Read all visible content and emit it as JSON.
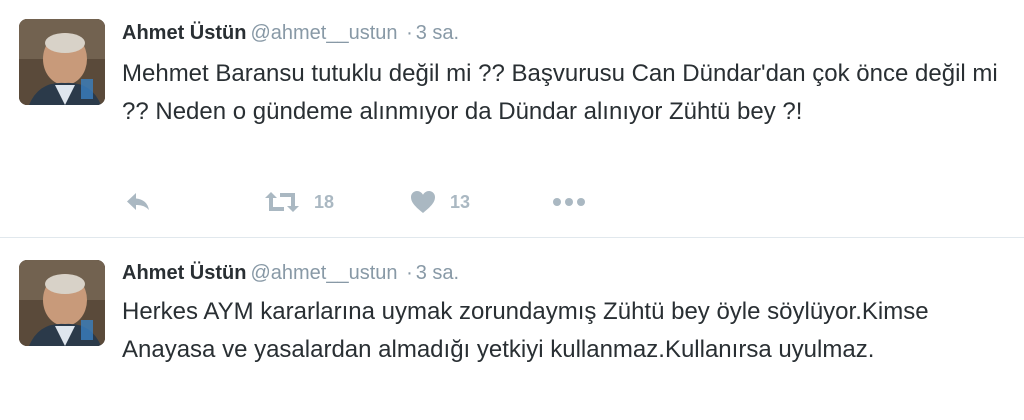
{
  "tweets": [
    {
      "fullname": "Ahmet Üstün",
      "username": "@ahmet__ustun",
      "separator": "·",
      "timestamp": "3 sa.",
      "text": "Mehmet Baransu tutuklu değil mi ?? Başvurusu Can Dündar'dan çok önce değil mi ?? Neden o gündeme alınmıyor da Dündar alınıyor Zühtü bey ?!",
      "retweets": "18",
      "likes": "13",
      "icons": {
        "reply": "reply-icon",
        "retweet": "retweet-icon",
        "like": "heart-icon",
        "more": "more-icon"
      }
    },
    {
      "fullname": "Ahmet Üstün",
      "username": "@ahmet__ustun",
      "separator": "·",
      "timestamp": "3 sa.",
      "text": "Herkes AYM kararlarına uymak zorundaymış Zühtü bey öyle söylüyor.Kimse Anayasa ve yasalardan almadığı yetkiyi kullanmaz.Kullanırsa uyulmaz."
    }
  ],
  "colors": {
    "text": "#292f33",
    "muted": "#8899a6",
    "icon": "#aab8c2",
    "divider": "#e1e8ed"
  }
}
